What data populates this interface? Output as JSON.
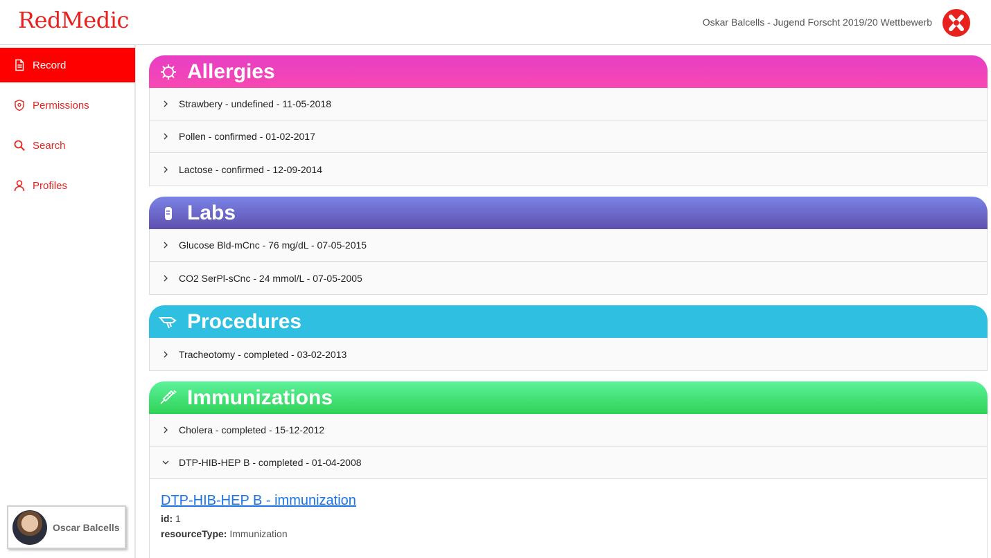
{
  "header": {
    "brand": "RedMedic",
    "title": "Oskar Balcells - Jugend Forscht 2019/20 Wettbewerb"
  },
  "sidebar": {
    "items": [
      {
        "label": "Record",
        "icon": "document-icon"
      },
      {
        "label": "Permissions",
        "icon": "shield-icon"
      },
      {
        "label": "Search",
        "icon": "search-icon"
      },
      {
        "label": "Profiles",
        "icon": "user-icon"
      }
    ],
    "profile": {
      "name": "Oscar Balcells"
    }
  },
  "sections": {
    "allergies": {
      "title": "Allergies",
      "color": "#f03fc0",
      "rows": [
        "Strawbery - undefined - 11-05-2018",
        "Pollen - confirmed - 01-02-2017",
        "Lactose - confirmed - 12-09-2014"
      ]
    },
    "labs": {
      "title": "Labs",
      "color": "#6f63c8",
      "rows": [
        "Glucose Bld-mCnc - 76 mg/dL - 07-05-2015",
        "CO2 SerPl-sCnc - 24 mmol/L - 07-05-2005"
      ]
    },
    "procedures": {
      "title": "Procedures",
      "color": "#2fbfe1",
      "rows": [
        "Tracheotomy - completed - 03-02-2013"
      ]
    },
    "immunizations": {
      "title": "Immunizations",
      "color": "#3fdc6e",
      "rows": [
        "Cholera - completed - 15-12-2012",
        "DTP-HIB-HEP B - completed - 01-04-2008"
      ]
    }
  },
  "detail": {
    "title": "DTP-HIB-HEP B - immunization",
    "fields": [
      {
        "key": "id:",
        "value": "1"
      },
      {
        "key": "resourceType:",
        "value": "Immunization"
      }
    ]
  }
}
